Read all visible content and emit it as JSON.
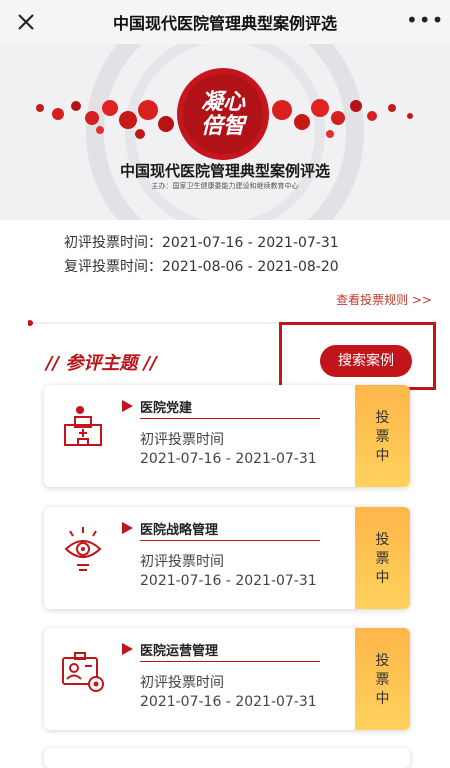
{
  "topbar": {
    "title": "中国现代医院管理典型案例评选"
  },
  "banner": {
    "logo_text_line1": "凝心",
    "logo_text_line2": "倍智",
    "title": "中国现代医院管理典型案例评选",
    "subtitle": "主办：国家卫生健康委能力建设和继续教育中心"
  },
  "periods": {
    "first": "初评投票时间：2021-07-16 - 2021-07-31",
    "second": "复评投票时间：2021-08-06 - 2021-08-20"
  },
  "rules_link": "查看投票规则 >>",
  "section": {
    "title": "// 参评主题 //",
    "search_label": "搜索案例"
  },
  "cards": [
    {
      "name": "医院党建",
      "label": "初评投票时间",
      "dates": "2021-07-16 - 2021-07-31",
      "status": [
        "投",
        "票",
        "中"
      ],
      "icon": "hospital-party-icon"
    },
    {
      "name": "医院战略管理",
      "label": "初评投票时间",
      "dates": "2021-07-16 - 2021-07-31",
      "status": [
        "投",
        "票",
        "中"
      ],
      "icon": "strategy-eye-icon"
    },
    {
      "name": "医院运营管理",
      "label": "初评投票时间",
      "dates": "2021-07-16 - 2021-07-31",
      "status": [
        "投",
        "票",
        "中"
      ],
      "icon": "operations-id-gear-icon"
    }
  ],
  "colors": {
    "accent": "#c0161b",
    "status_bg": "#ffc24f",
    "highlight": "#c21616"
  }
}
